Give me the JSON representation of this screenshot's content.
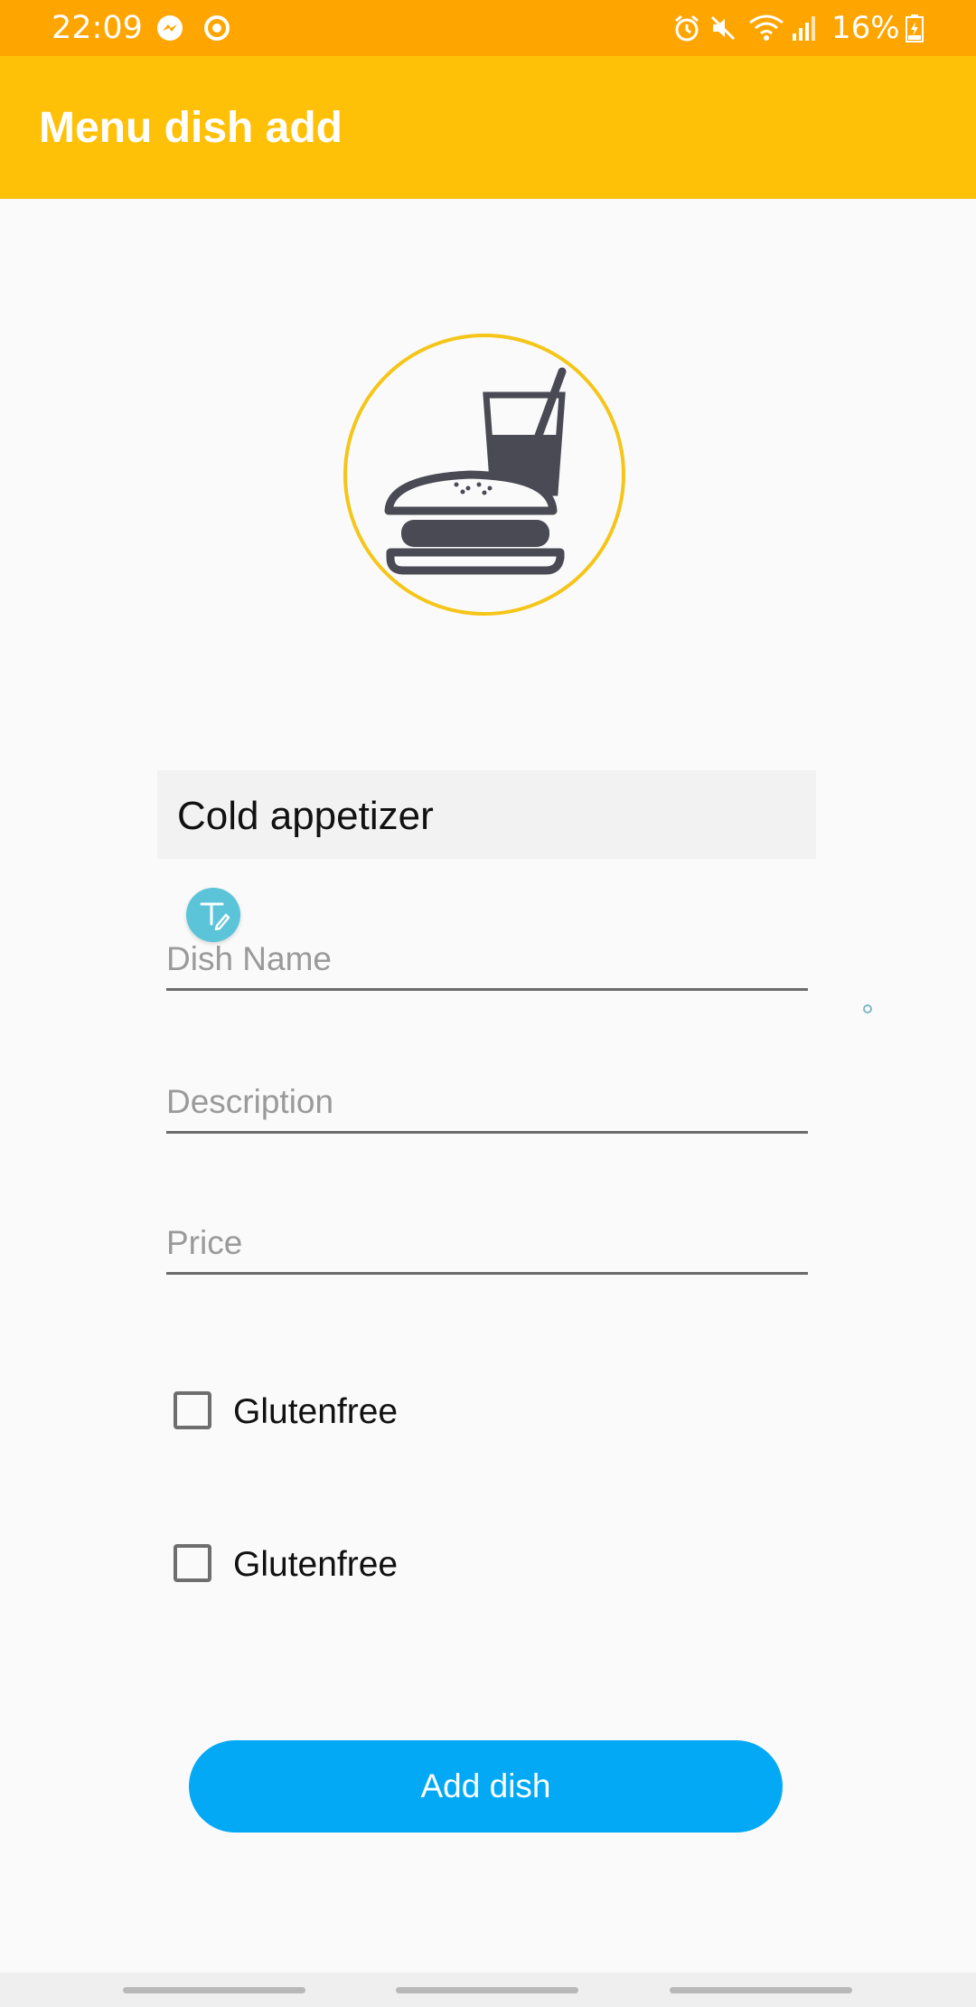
{
  "status_bar": {
    "time": "22:09",
    "battery_percent": "16%",
    "left_icons": [
      "messenger-icon",
      "sync-icon"
    ],
    "right_icons": [
      "alarm-icon",
      "mute-icon",
      "wifi-icon",
      "signal-icon",
      "battery-icon"
    ]
  },
  "app_bar": {
    "title": "Menu dish add"
  },
  "form": {
    "category": "Cold appetizer",
    "dish_name_placeholder": "Dish Name",
    "description_placeholder": "Description",
    "price_placeholder": "Price",
    "checkboxes": [
      {
        "label": "Glutenfree",
        "checked": false
      },
      {
        "label": "Glutenfree",
        "checked": false
      }
    ],
    "submit_label": "Add dish"
  },
  "colors": {
    "status_bar": "#FFA500",
    "app_bar": "#FFC107",
    "accent_circle": "#F5C518",
    "button": "#03A9F4",
    "icon_dark": "#4A4A55"
  }
}
